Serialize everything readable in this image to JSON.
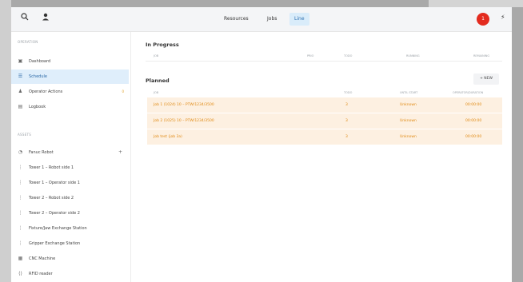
{
  "topbar": {
    "tabs": [
      {
        "label": "Resources",
        "active": false
      },
      {
        "label": "Jobs",
        "active": false
      },
      {
        "label": "Line",
        "active": true
      }
    ],
    "avatar_text": "1",
    "icons": [
      "search-icon",
      "user-icon",
      "bolt-icon"
    ]
  },
  "sidebar": {
    "section1_title": "Operation",
    "items1": [
      {
        "label": "Dashboard",
        "icon": "dashboard-icon"
      },
      {
        "label": "Schedule",
        "icon": "schedule-icon",
        "active": true
      },
      {
        "label": "Operator Actions",
        "icon": "operator-icon",
        "badge": "0"
      },
      {
        "label": "Logbook",
        "icon": "logbook-icon"
      }
    ],
    "section2_title": "Assets",
    "items2": [
      {
        "label": "Fanuc Robot",
        "icon": "robot-icon"
      },
      {
        "label": "Tower 1 – Robot side 1",
        "icon": "tower-icon"
      },
      {
        "label": "Tower 1 – Operator side 1",
        "icon": "tower-icon"
      },
      {
        "label": "Tower 2 – Robot side 2",
        "icon": "tower-icon"
      },
      {
        "label": "Tower 2 – Operator side 2",
        "icon": "tower-icon"
      },
      {
        "label": "Fixture/Jaw Exchange Station",
        "icon": "station-icon"
      },
      {
        "label": "Gripper Exchange Station",
        "icon": "gripper-icon"
      },
      {
        "label": "CNC Machine",
        "icon": "cnc-icon"
      },
      {
        "label": "RFID reader",
        "icon": "rfid-icon"
      }
    ]
  },
  "main": {
    "in_progress": {
      "title": "In Progress",
      "columns": [
        "Job",
        "Prio",
        "Todo",
        "Running",
        "Remaining"
      ]
    },
    "planned": {
      "title": "Planned",
      "new_label": "+ NEW",
      "columns": [
        "Job",
        "Todo",
        "Until start",
        "Operator/Duration"
      ],
      "rows": [
        {
          "job": "Job 1 (1024) 10 – PTW/1234/3500",
          "todo": "3",
          "until": "Unknown",
          "duration": "00:00:00"
        },
        {
          "job": "Job 2 (1025) 10 – PTW/1234/3500",
          "todo": "3",
          "until": "Unknown",
          "duration": "00:00:00"
        },
        {
          "job": "Job test (job 3a)",
          "todo": "3",
          "until": "Unknown",
          "duration": "00:00:00"
        }
      ]
    }
  }
}
